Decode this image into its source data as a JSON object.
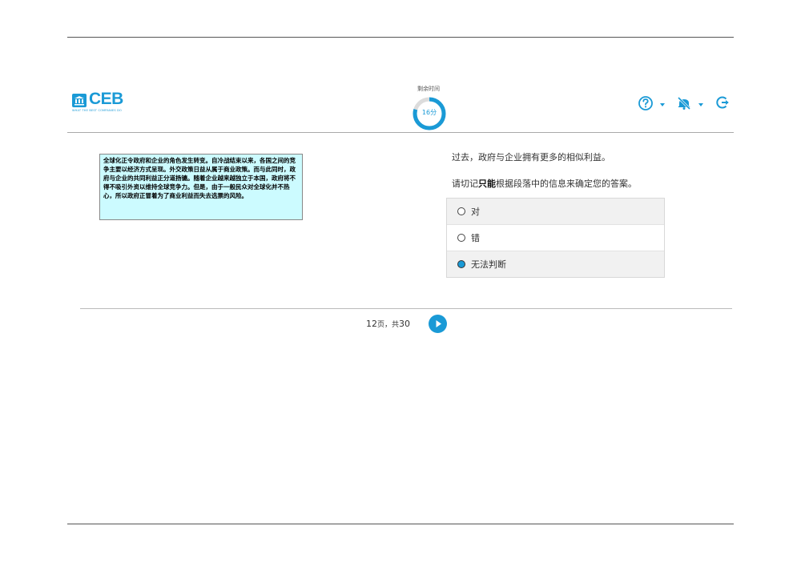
{
  "header": {
    "logo_text": "CEB",
    "logo_tagline": "WHAT THE BEST COMPANIES DO",
    "timer_label": "剩余时间",
    "timer_value": "16分"
  },
  "passage": {
    "text": "全球化正令政府和企业的角色发生转变。自冷战结束以来，各国之间的竞争主要以经济方式呈现。外交政策日益从属于商业政策。而与此同时，政府与企业的共同利益正分道扬镳。随着企业越来越独立于本国，政府将不得不吸引外资以维持全球竞争力。但是，由于一般民众对全球化并不热心，所以政府正冒着为了商业利益而失去选票的风险。"
  },
  "question": {
    "statement": "过去，政府与企业拥有更多的相似利益。",
    "instruction_prefix": "请切记",
    "instruction_bold": "只能",
    "instruction_suffix": "根据段落中的信息来确定您的答案。",
    "options": [
      {
        "label": "对",
        "selected": false
      },
      {
        "label": "错",
        "selected": false
      },
      {
        "label": "无法判断",
        "selected": true
      }
    ]
  },
  "pager": {
    "current": "12",
    "page_word": "页，共",
    "total": "30"
  },
  "colors": {
    "accent": "#1a9ad6",
    "passage_bg": "#ccfbff"
  },
  "icons": {
    "help": "help-circle-icon",
    "sound": "sound-off-icon",
    "exit": "exit-icon",
    "next": "play-arrow-icon"
  }
}
